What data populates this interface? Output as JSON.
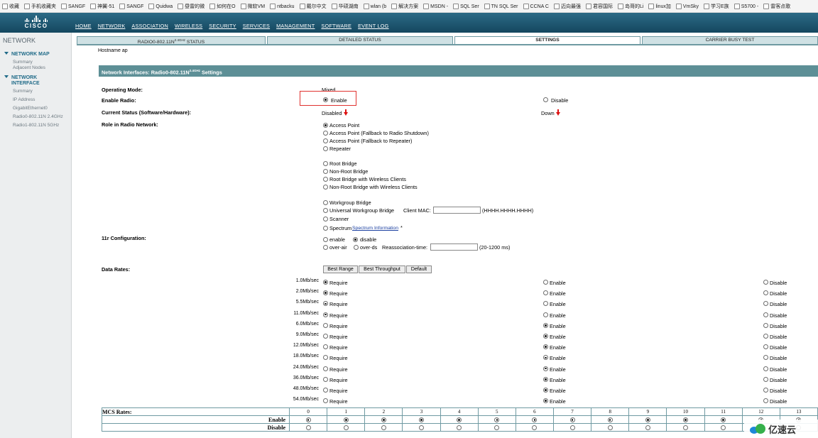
{
  "bookmarks": [
    "收藏",
    "手机收藏夹",
    "SANGF",
    "神翼-51",
    "SANGF",
    "Quidwa",
    "昼雷的微",
    "如何在O",
    "微软VM",
    "ntbacku",
    "戴尔中文",
    "华硕湖南",
    "wlan (b",
    "解决方案",
    "MSDN -",
    "SQL Ser",
    "TN SQL Ser",
    "CCNA C",
    "迈向最强",
    "君容国际",
    "岛哥的Li",
    "linux加",
    "VmSky",
    "学习E族",
    "S5700 -",
    "雷客点歌"
  ],
  "logo": "CISCO",
  "nav": [
    "HOME",
    "NETWORK",
    "ASSOCIATION",
    "WIRELESS",
    "SECURITY",
    "SERVICES",
    "MANAGEMENT",
    "SOFTWARE",
    "EVENT LOG"
  ],
  "sidebar": {
    "title": "NETWORK",
    "sections": [
      {
        "label": "NETWORK MAP",
        "items": [
          "Summary",
          "Adjacent Nodes"
        ]
      },
      {
        "label": "NETWORK\nINTERFACE",
        "items": [
          "Summary",
          "IP Address",
          "GigabitEthernet0",
          "Radio0-802.11N 2.4GHz",
          "Radio1-802.11N 5GHz"
        ]
      }
    ]
  },
  "tabs": [
    {
      "label": "RADIO0-802.11N",
      "sup": "2.4GHz",
      "suffix": " STATUS"
    },
    {
      "label": "DETAILED STATUS"
    },
    {
      "label": "SETTINGS"
    },
    {
      "label": "CARRIER BUSY TEST"
    }
  ],
  "hostname": "Hostname  ap",
  "interface_bar": {
    "text": "Network Interfaces: Radio0-802.11N",
    "sup": "2.4GHz",
    "suffix": " Settings"
  },
  "form": {
    "operating_mode_label": "Operating Mode:",
    "operating_mode_value": "Mixed",
    "enable_radio_label": "Enable Radio:",
    "enable_label": "Enable",
    "disable_label": "Disable",
    "current_status_label": "Current Status (Software/Hardware):",
    "status_software": "Disabled",
    "status_hardware": "Down",
    "role_label": "Role in Radio Network:",
    "roles": [
      "Access Point",
      "Access Point (Fallback to Radio Shutdown)",
      "Access Point (Fallback to Repeater)",
      "Repeater",
      "Root Bridge",
      "Non-Root Bridge",
      "Root Bridge with Wireless Clients",
      "Non-Root Bridge with Wireless Clients",
      "Workgroup Bridge",
      "Universal Workgroup Bridge",
      "Scanner",
      "Spectrum"
    ],
    "client_mac_label": "Client MAC:",
    "client_mac_hint": "(HHHH.HHHH.HHHH)",
    "spectrum_link": "Spectrum Information",
    "spectrum_star": "*",
    "r11_label": "11r Configuration:",
    "r11_enable": "enable",
    "r11_disable": "disable",
    "r11_overair": "over-air",
    "r11_overds": "over-ds",
    "reassoc_label": "Reassociation-time:",
    "reassoc_hint": "(20-1200 ms)",
    "data_rates_label": "Data Rates:",
    "buttons": [
      "Best Range",
      "Best Throughput",
      "Default"
    ]
  },
  "rates": [
    {
      "rate": "1.0Mb/sec",
      "sel": "require"
    },
    {
      "rate": "2.0Mb/sec",
      "sel": "require"
    },
    {
      "rate": "5.5Mb/sec",
      "sel": "require"
    },
    {
      "rate": "11.0Mb/sec",
      "sel": "require"
    },
    {
      "rate": "6.0Mb/sec",
      "sel": "enable"
    },
    {
      "rate": "9.0Mb/sec",
      "sel": "enable"
    },
    {
      "rate": "12.0Mb/sec",
      "sel": "enable"
    },
    {
      "rate": "18.0Mb/sec",
      "sel": "enable"
    },
    {
      "rate": "24.0Mb/sec",
      "sel": "enable"
    },
    {
      "rate": "36.0Mb/sec",
      "sel": "enable"
    },
    {
      "rate": "48.0Mb/sec",
      "sel": "enable"
    },
    {
      "rate": "54.0Mb/sec",
      "sel": "enable"
    }
  ],
  "rate_labels": {
    "require": "Require",
    "enable": "Enable",
    "disable": "Disable"
  },
  "mcs": {
    "title": "MCS Rates:",
    "enable_label": "Enable",
    "disable_label": "Disable",
    "indexes": [
      "0",
      "1",
      "2",
      "3",
      "4",
      "5",
      "6",
      "7",
      "8",
      "9",
      "10",
      "11",
      "12",
      "13"
    ]
  },
  "watermark": "亿速云"
}
